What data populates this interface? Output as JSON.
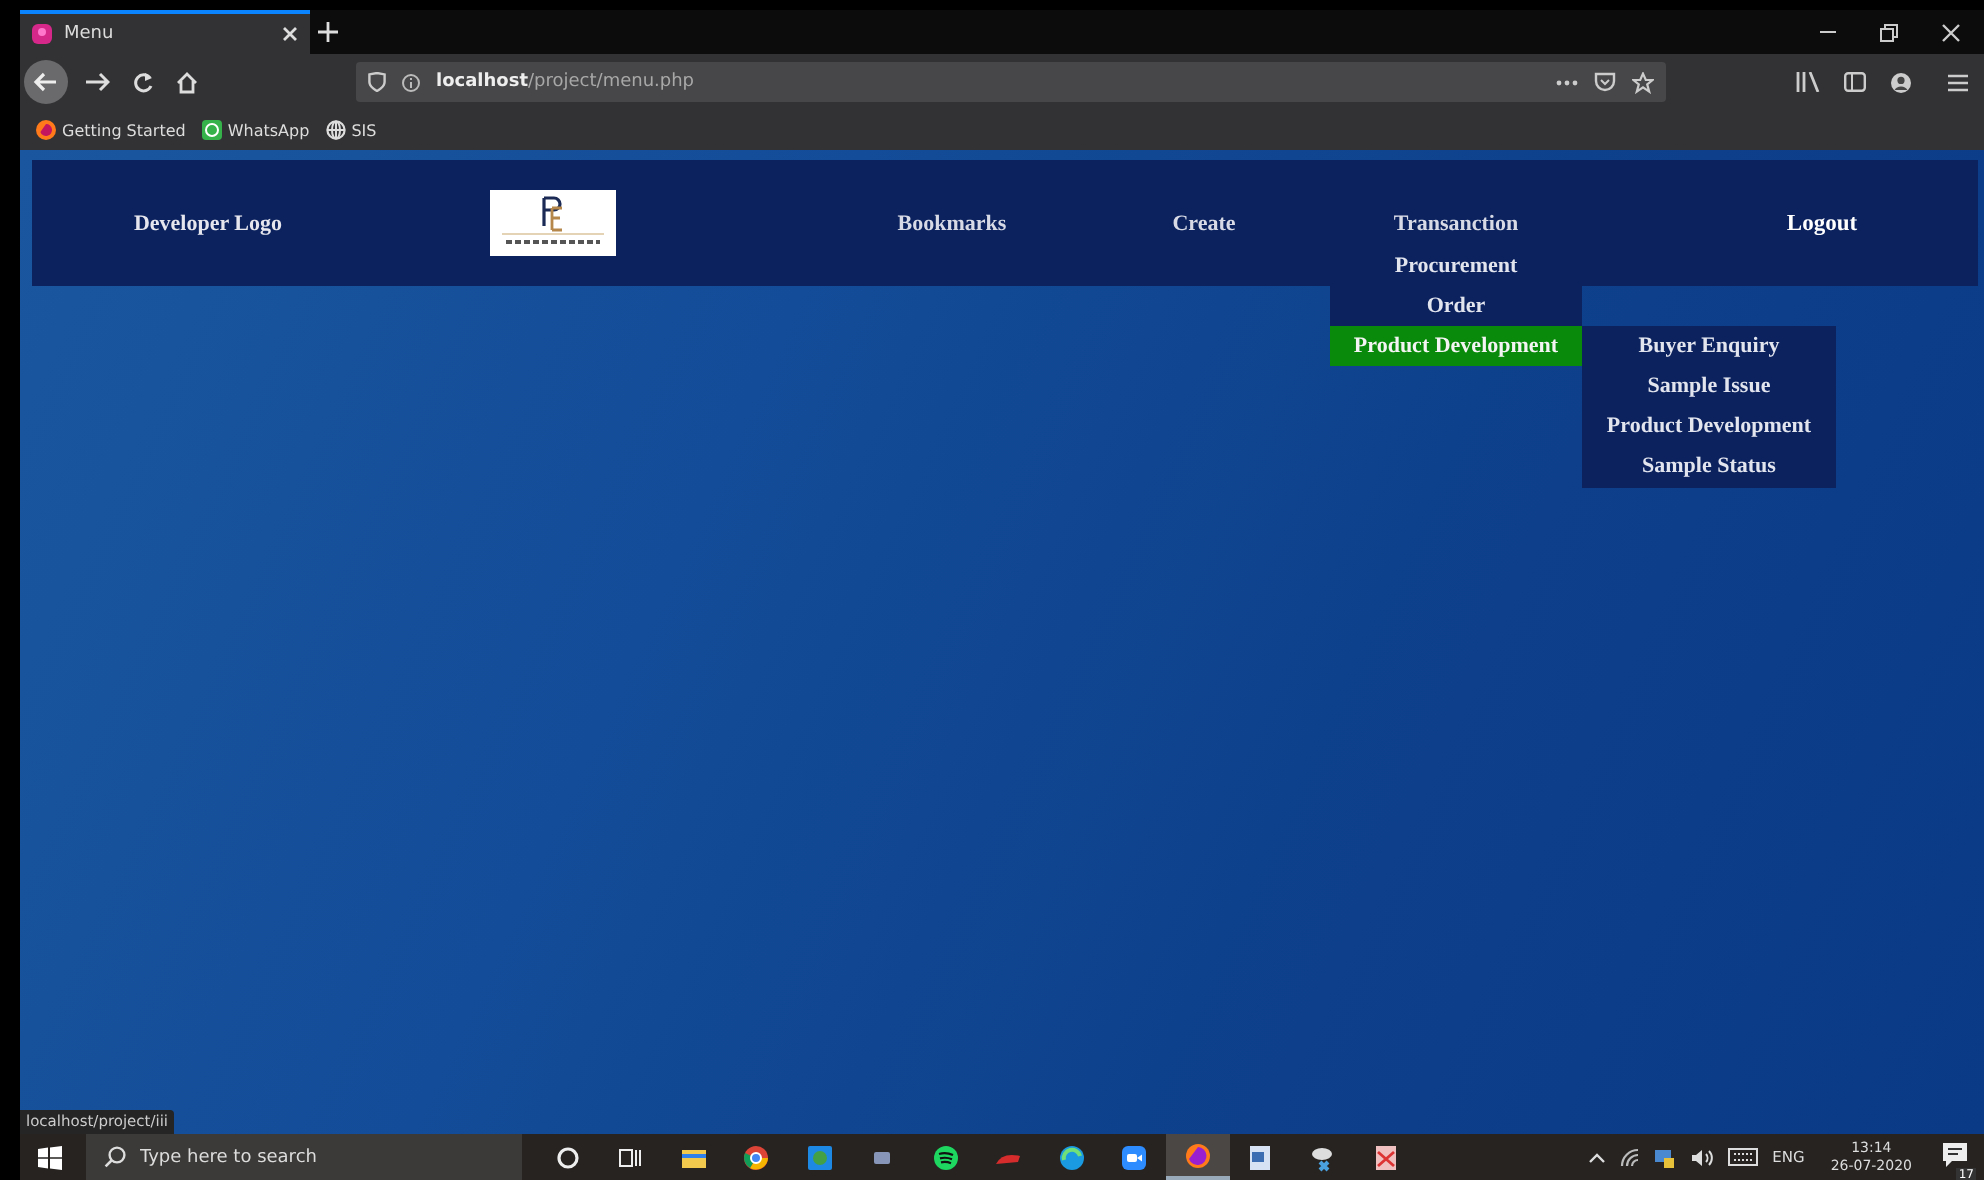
{
  "browser": {
    "tabs": [
      {
        "title": "Menu",
        "selected": true
      }
    ],
    "address": "**localhost**/project/menu.php",
    "bookmarks": [
      {
        "label": "Getting Started",
        "kind": "firefox"
      },
      {
        "label": "WhatsApp",
        "kind": "chat"
      },
      {
        "label": "SIS",
        "kind": "globe"
      }
    ]
  },
  "navbar": {
    "brand": "Developer Logo",
    "items": [
      {
        "label": "Bookmarks"
      },
      {
        "label": "Create"
      },
      {
        "label": "Transanction",
        "expanded": true,
        "children": [
          {
            "label": "Procurement",
            "selected": false
          },
          {
            "label": "Order",
            "selected": false
          },
          {
            "label": "Product Development",
            "selected": true,
            "expanded": true,
            "children": [
              {
                "label": "Buyer Enquiry"
              },
              {
                "label": "Sample Issue"
              },
              {
                "label": "Product Development"
              },
              {
                "label": "Sample Status"
              }
            ]
          }
        ]
      }
    ],
    "logout": "Logout"
  },
  "status_link": "localhost/project/iii",
  "taskbar": {
    "search_placeholder": "Type here to search",
    "language": "ENG",
    "time": "13:14",
    "date": "26-07-2020",
    "notification_count": "17"
  }
}
